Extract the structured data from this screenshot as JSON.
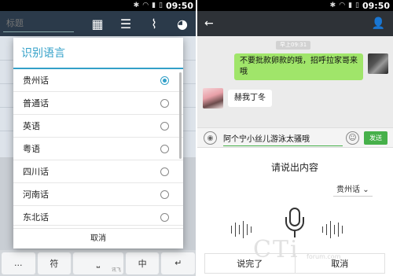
{
  "left": {
    "status": {
      "time": "09:50"
    },
    "toolbar": {
      "title_placeholder": "标题"
    },
    "dialog": {
      "title": "识别语言",
      "options": [
        "贵州话",
        "普通话",
        "英语",
        "粤语",
        "四川话",
        "河南话",
        "东北话"
      ],
      "selected": "贵州话",
      "cancel": "取消"
    },
    "keyboard": {
      "keys": [
        "...",
        "符",
        "",
        "中",
        ""
      ],
      "space_sub": "讯飞"
    }
  },
  "right": {
    "status": {
      "time": "09:50"
    },
    "chat": {
      "timestamp": "早上09:31",
      "outgoing": "不要批款卵款的哦，招呼拉家哥来哦",
      "incoming": "赫我丁冬",
      "input_value": "阿个宁小丝儿游泳太骚哦",
      "send": "发送"
    },
    "voice": {
      "prompt": "请说出内容",
      "language": "贵州话",
      "done": "说完了",
      "cancel": "取消"
    },
    "watermark": "CTi",
    "watermark_sub": "forum.com"
  },
  "colors": {
    "accent": "#33a0c8",
    "wechat_green": "#46b04a",
    "bubble_green": "#a0e56a"
  }
}
